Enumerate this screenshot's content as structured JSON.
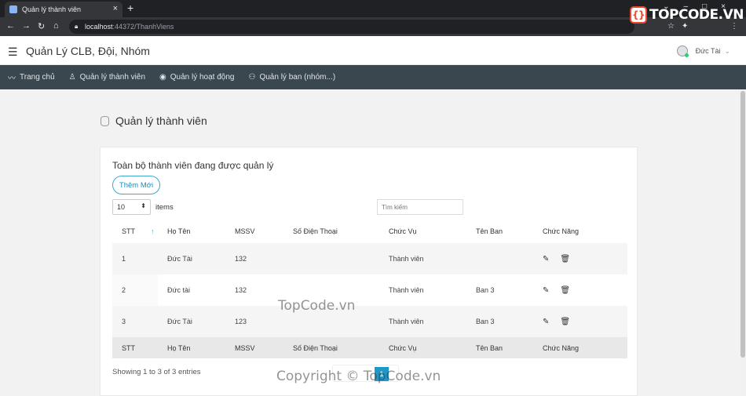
{
  "browser": {
    "tab_title": "Quản lý thành viên",
    "url_host": "localhost",
    "url_path": ":44372/ThanhViens",
    "brand": "TOPCODE.VN"
  },
  "app": {
    "title": "Quản Lý CLB, Đội, Nhóm",
    "user_name": "Đức Tài"
  },
  "menu": [
    {
      "label": "Trang chủ",
      "icon": "activity-icon"
    },
    {
      "label": "Quản lý thành viên",
      "icon": "user-icon"
    },
    {
      "label": "Quản lý hoạt động",
      "icon": "eye-icon"
    },
    {
      "label": "Quản lý ban (nhóm...)",
      "icon": "users-icon"
    }
  ],
  "page": {
    "heading": "Quản lý thành viên",
    "card_title": "Toàn bộ thành viên đang được quản lý",
    "add_button": "Thêm Mới",
    "page_length": "10",
    "length_label": "items",
    "search_placeholder": "Tìm kiếm",
    "info": "Showing 1 to 3 of 3 entries",
    "current_page": "1"
  },
  "table": {
    "columns": [
      "STT",
      "Họ Tên",
      "MSSV",
      "Số Điện Thoại",
      "Chức Vụ",
      "Tên Ban",
      "Chức Năng"
    ],
    "rows": [
      {
        "stt": "1",
        "name": "Đức Tài",
        "mssv": "132",
        "phone": "",
        "role": "Thành viên",
        "team": ""
      },
      {
        "stt": "2",
        "name": "Đức tài",
        "mssv": "132",
        "phone": "",
        "role": "Thành viên",
        "team": "Ban 3"
      },
      {
        "stt": "3",
        "name": "Đức Tài",
        "mssv": "123",
        "phone": "",
        "role": "Thành viên",
        "team": "Ban 3"
      }
    ]
  },
  "watermarks": {
    "center": "TopCode.vn",
    "bottom": "Copyright © TopCode.vn"
  }
}
